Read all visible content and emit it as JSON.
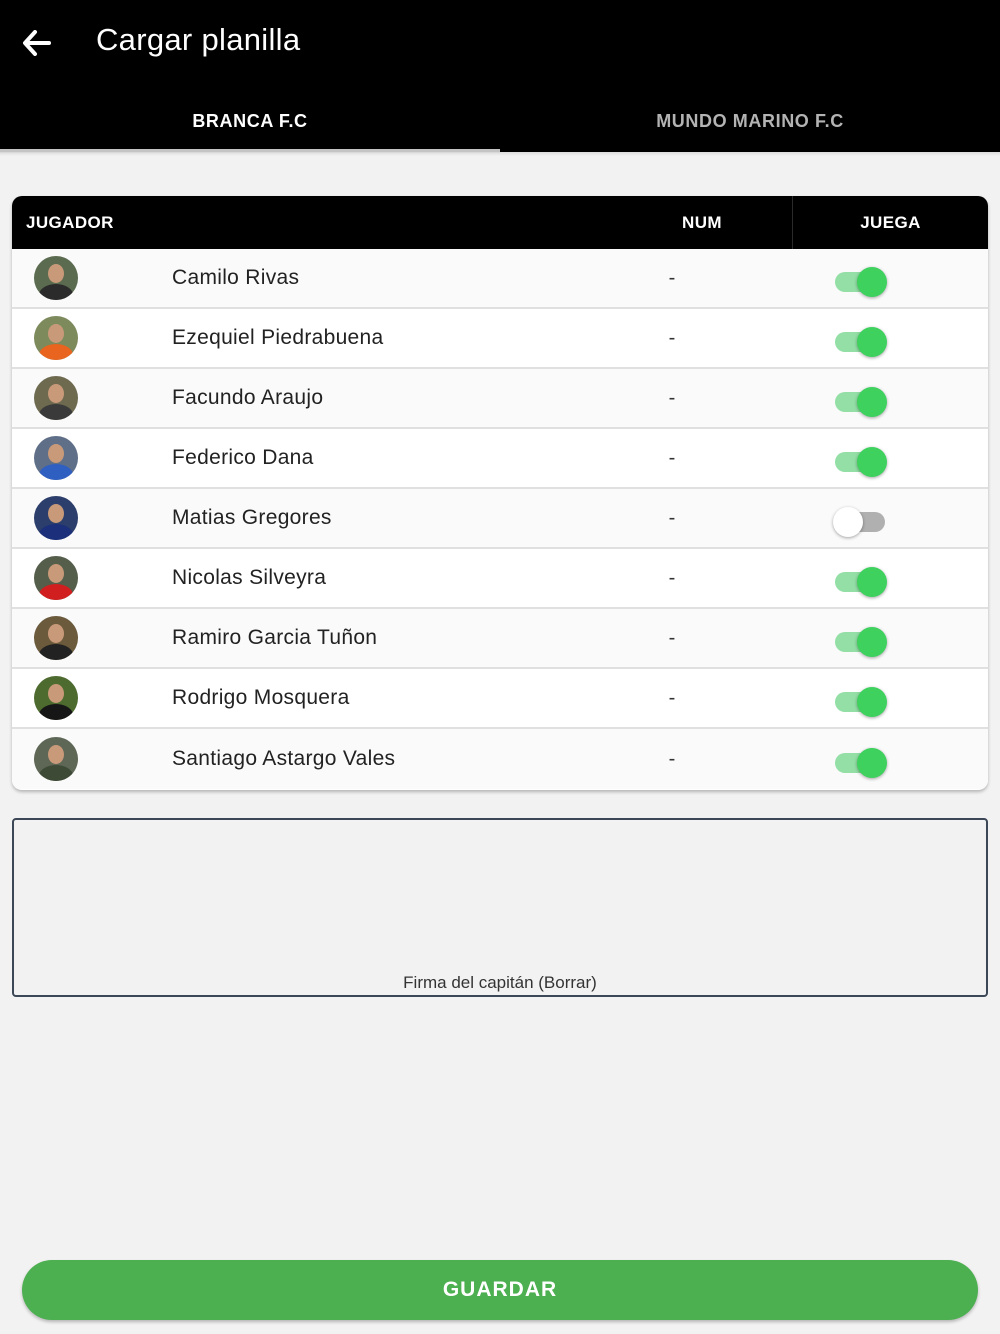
{
  "header": {
    "title": "Cargar planilla",
    "back_icon": "arrow-left-icon"
  },
  "tabs": [
    {
      "label": "BRANCA F.C",
      "active": true
    },
    {
      "label": "MUNDO MARINO F.C",
      "active": false
    }
  ],
  "table": {
    "columns": {
      "player": "JUGADOR",
      "number": "NUM",
      "plays": "JUEGA"
    },
    "rows": [
      {
        "name": "Camilo Rivas",
        "number": "-",
        "plays": true
      },
      {
        "name": "Ezequiel Piedrabuena",
        "number": "-",
        "plays": true
      },
      {
        "name": "Facundo Araujo",
        "number": "-",
        "plays": true
      },
      {
        "name": "Federico Dana",
        "number": "-",
        "plays": true
      },
      {
        "name": "Matias Gregores",
        "number": "-",
        "plays": false
      },
      {
        "name": "Nicolas Silveyra",
        "number": "-",
        "plays": true
      },
      {
        "name": "Ramiro Garcia Tuñon",
        "number": "-",
        "plays": true
      },
      {
        "name": "Rodrigo Mosquera",
        "number": "-",
        "plays": true
      },
      {
        "name": "Santiago Astargo Vales",
        "number": "-",
        "plays": true
      }
    ]
  },
  "signature": {
    "caption": "Firma del capitán (Borrar)"
  },
  "actions": {
    "save_label": "GUARDAR"
  },
  "colors": {
    "header_bg": "#000000",
    "toggle_on": "#3ed15e",
    "save_button": "#4caf50"
  }
}
